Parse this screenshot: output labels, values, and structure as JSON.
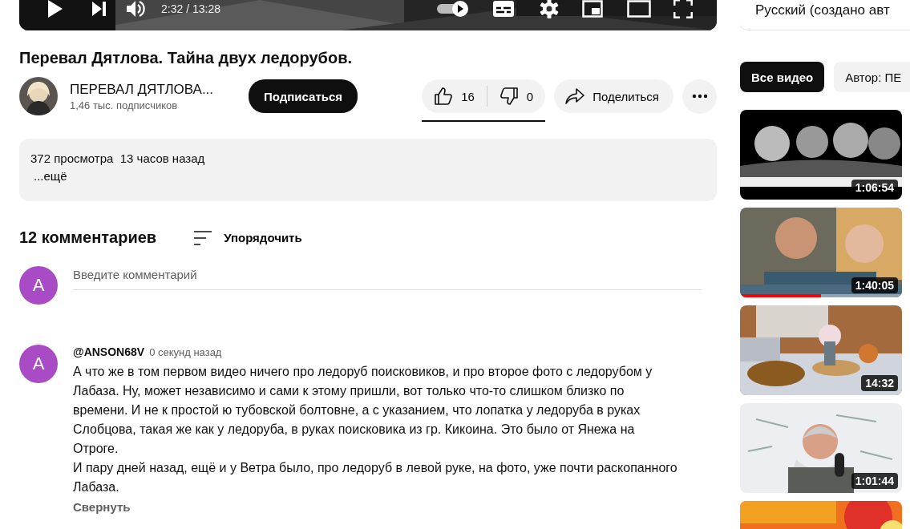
{
  "player": {
    "time": "2:32 / 13:28",
    "autoplay_on": true
  },
  "caption_track": "Русский (создано авт",
  "video": {
    "title": "Перевал Дятлова. Тайна двух ледорубов."
  },
  "channel": {
    "name": "ПЕРЕВАЛ ДЯТЛОВА...",
    "subscribers": "1,46 тыс. подписчиков",
    "subscribe_label": "Подписаться"
  },
  "actions": {
    "likes": "16",
    "dislikes": "0",
    "like_ratio": {
      "level": 1
    },
    "share_label": "Поделиться"
  },
  "description": {
    "stats": "372 просмотра  13 часов назад",
    "more": "...ещё"
  },
  "comments": {
    "count": "12 комментариев",
    "sort_label": "Упорядочить",
    "input": {
      "placeholder": "Введите комментарий",
      "avatar_letter": "A"
    },
    "items": [
      {
        "avatar_letter": "A",
        "author": "@ANSON68V",
        "time": "0 секунд назад",
        "text": "А что же в том первом видео ничего про ледоруб поисковиков, и про второе фото с ледорубом у Лабаза. Ну, может независимо и сами к этому пришли, вот только что-то слишком близко по времени. И не к простой ю тубовской болтовне, а  с указанием, что лопатка у ледоруба в руках Слобцова, такая же как у ледоруба, в руках поисковика из гр. Кикоина. Это было от Янежа на Отроге.\nИ пару дней назад, ещё и у Ветра было, про ледоруб в левой руке, на фото, уже почти раскопанного Лабаза.",
        "collapse_label": "Свернуть"
      }
    ]
  },
  "sidebar": {
    "chips": [
      {
        "label": "Все видео",
        "selected": true
      },
      {
        "label": "Автор: ПЕ",
        "selected": false
      }
    ],
    "videos": [
      {
        "duration": "1:06:54",
        "kind": "picture"
      },
      {
        "duration": "1:40:05",
        "kind": "picture",
        "watched": {
          "level": 0.5
        }
      },
      {
        "duration": "14:32",
        "kind": "picture"
      },
      {
        "duration": "1:01:44",
        "kind": "picture"
      },
      {
        "kind": "picture"
      }
    ]
  }
}
